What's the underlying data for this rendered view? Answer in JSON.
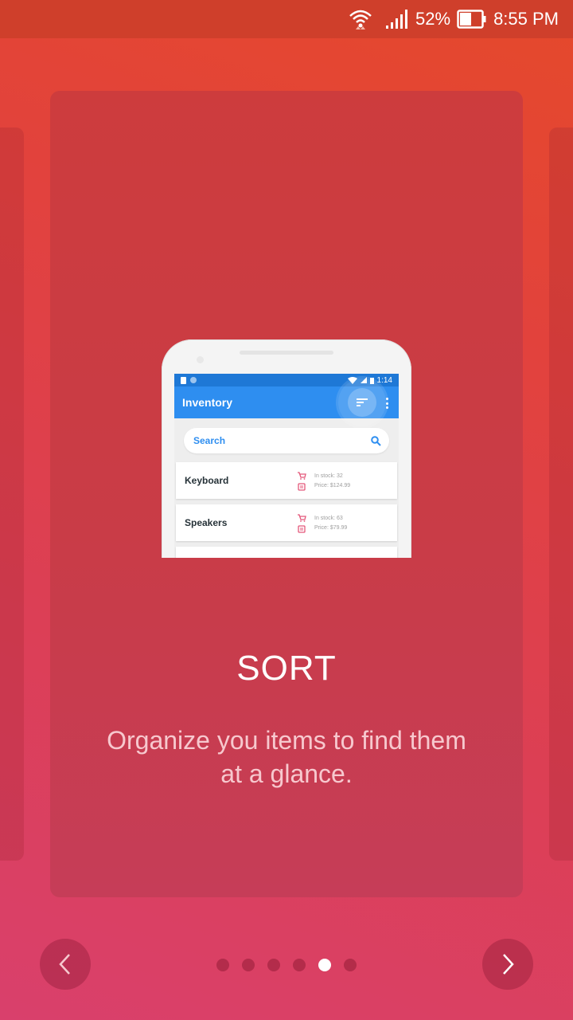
{
  "status_bar": {
    "battery_percent": "52%",
    "time": "8:55 PM",
    "icons": [
      "wifi-icon",
      "signal-icon",
      "battery-icon"
    ]
  },
  "slide": {
    "title": "SORT",
    "description": "Organize you items to find them at a glance."
  },
  "mockup": {
    "status_time": "1:14",
    "app_title": "Inventory",
    "search_label": "Search",
    "items": [
      {
        "name": "Keyboard",
        "stock": "In stock: 32",
        "price": "Price: $124.99"
      },
      {
        "name": "Speakers",
        "stock": "In stock: 63",
        "price": "Price: $79.99"
      }
    ],
    "colors": {
      "app_bar": "#2e8ef0",
      "status": "#1e78d6",
      "accent_icon": "#e4577a"
    }
  },
  "pager": {
    "total_pages": 6,
    "current_page": 5
  },
  "navigation": {
    "prev_icon": "chevron-left-icon",
    "next_icon": "chevron-right-icon"
  },
  "colors": {
    "background_top": "#e5492b",
    "background_bottom": "#d9406c",
    "status_bar": "#cf3f2b",
    "active_dot": "#ffffff"
  }
}
